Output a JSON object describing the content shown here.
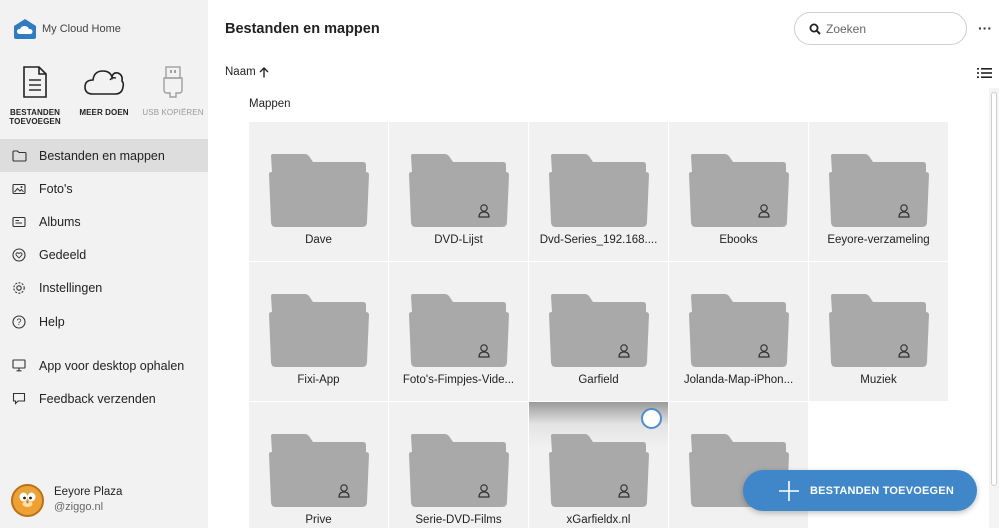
{
  "app": {
    "logo_text": "My Cloud Home"
  },
  "quick_actions": [
    {
      "label_line1": "BESTANDEN",
      "label_line2": "TOEVOEGEN",
      "icon": "document-icon",
      "enabled": true
    },
    {
      "label_line1": "MEER DOEN",
      "label_line2": "",
      "icon": "cloud-icon",
      "enabled": true
    },
    {
      "label_line1": "USB KOPIËREN",
      "label_line2": "",
      "icon": "usb-icon",
      "enabled": false
    }
  ],
  "nav": [
    {
      "label": "Bestanden en mappen",
      "icon": "folder-icon",
      "active": true
    },
    {
      "label": "Foto's",
      "icon": "photo-icon",
      "active": false
    },
    {
      "label": "Albums",
      "icon": "album-icon",
      "active": false
    },
    {
      "label": "Gedeeld",
      "icon": "shared-icon",
      "active": false
    },
    {
      "label": "Instellingen",
      "icon": "gear-icon",
      "active": false
    },
    {
      "label": "Help",
      "icon": "help-icon",
      "active": false
    },
    {
      "label": "App voor desktop ophalen",
      "icon": "desktop-icon",
      "active": false
    },
    {
      "label": "Feedback verzenden",
      "icon": "feedback-icon",
      "active": false
    }
  ],
  "user": {
    "name": "Eeyore Plaza",
    "email": "@ziggo.nl"
  },
  "header": {
    "title": "Bestanden en mappen",
    "search_placeholder": "Zoeken",
    "more_label": "···"
  },
  "sort": {
    "label": "Naam",
    "direction": "ascending"
  },
  "section_label": "Mappen",
  "folders": [
    {
      "name": "Dave",
      "shared": false
    },
    {
      "name": "DVD-Lijst",
      "shared": true
    },
    {
      "name": "Dvd-Series_192.168....",
      "shared": false
    },
    {
      "name": "Ebooks",
      "shared": true
    },
    {
      "name": "Eeyore-verzameling",
      "shared": true
    },
    {
      "name": "Fixi-App",
      "shared": false
    },
    {
      "name": "Foto's-Fimpjes-Vide...",
      "shared": true
    },
    {
      "name": "Garfield",
      "shared": true
    },
    {
      "name": "Jolanda-Map-iPhon...",
      "shared": true
    },
    {
      "name": "Muziek",
      "shared": true
    },
    {
      "name": "Prive",
      "shared": true
    },
    {
      "name": "Serie-DVD-Films",
      "shared": true
    },
    {
      "name": "xGarfieldx.nl",
      "shared": true,
      "hover": true
    },
    {
      "name": "",
      "shared": false
    }
  ],
  "fab": {
    "label": "BESTANDEN TOEVOEGEN"
  },
  "colors": {
    "accent": "#3f87c8",
    "sidebar_bg": "#f2f2f2",
    "active_bg": "#dddddd",
    "folder": "#a9a9a9",
    "tile_bg": "#f1f1f1"
  }
}
